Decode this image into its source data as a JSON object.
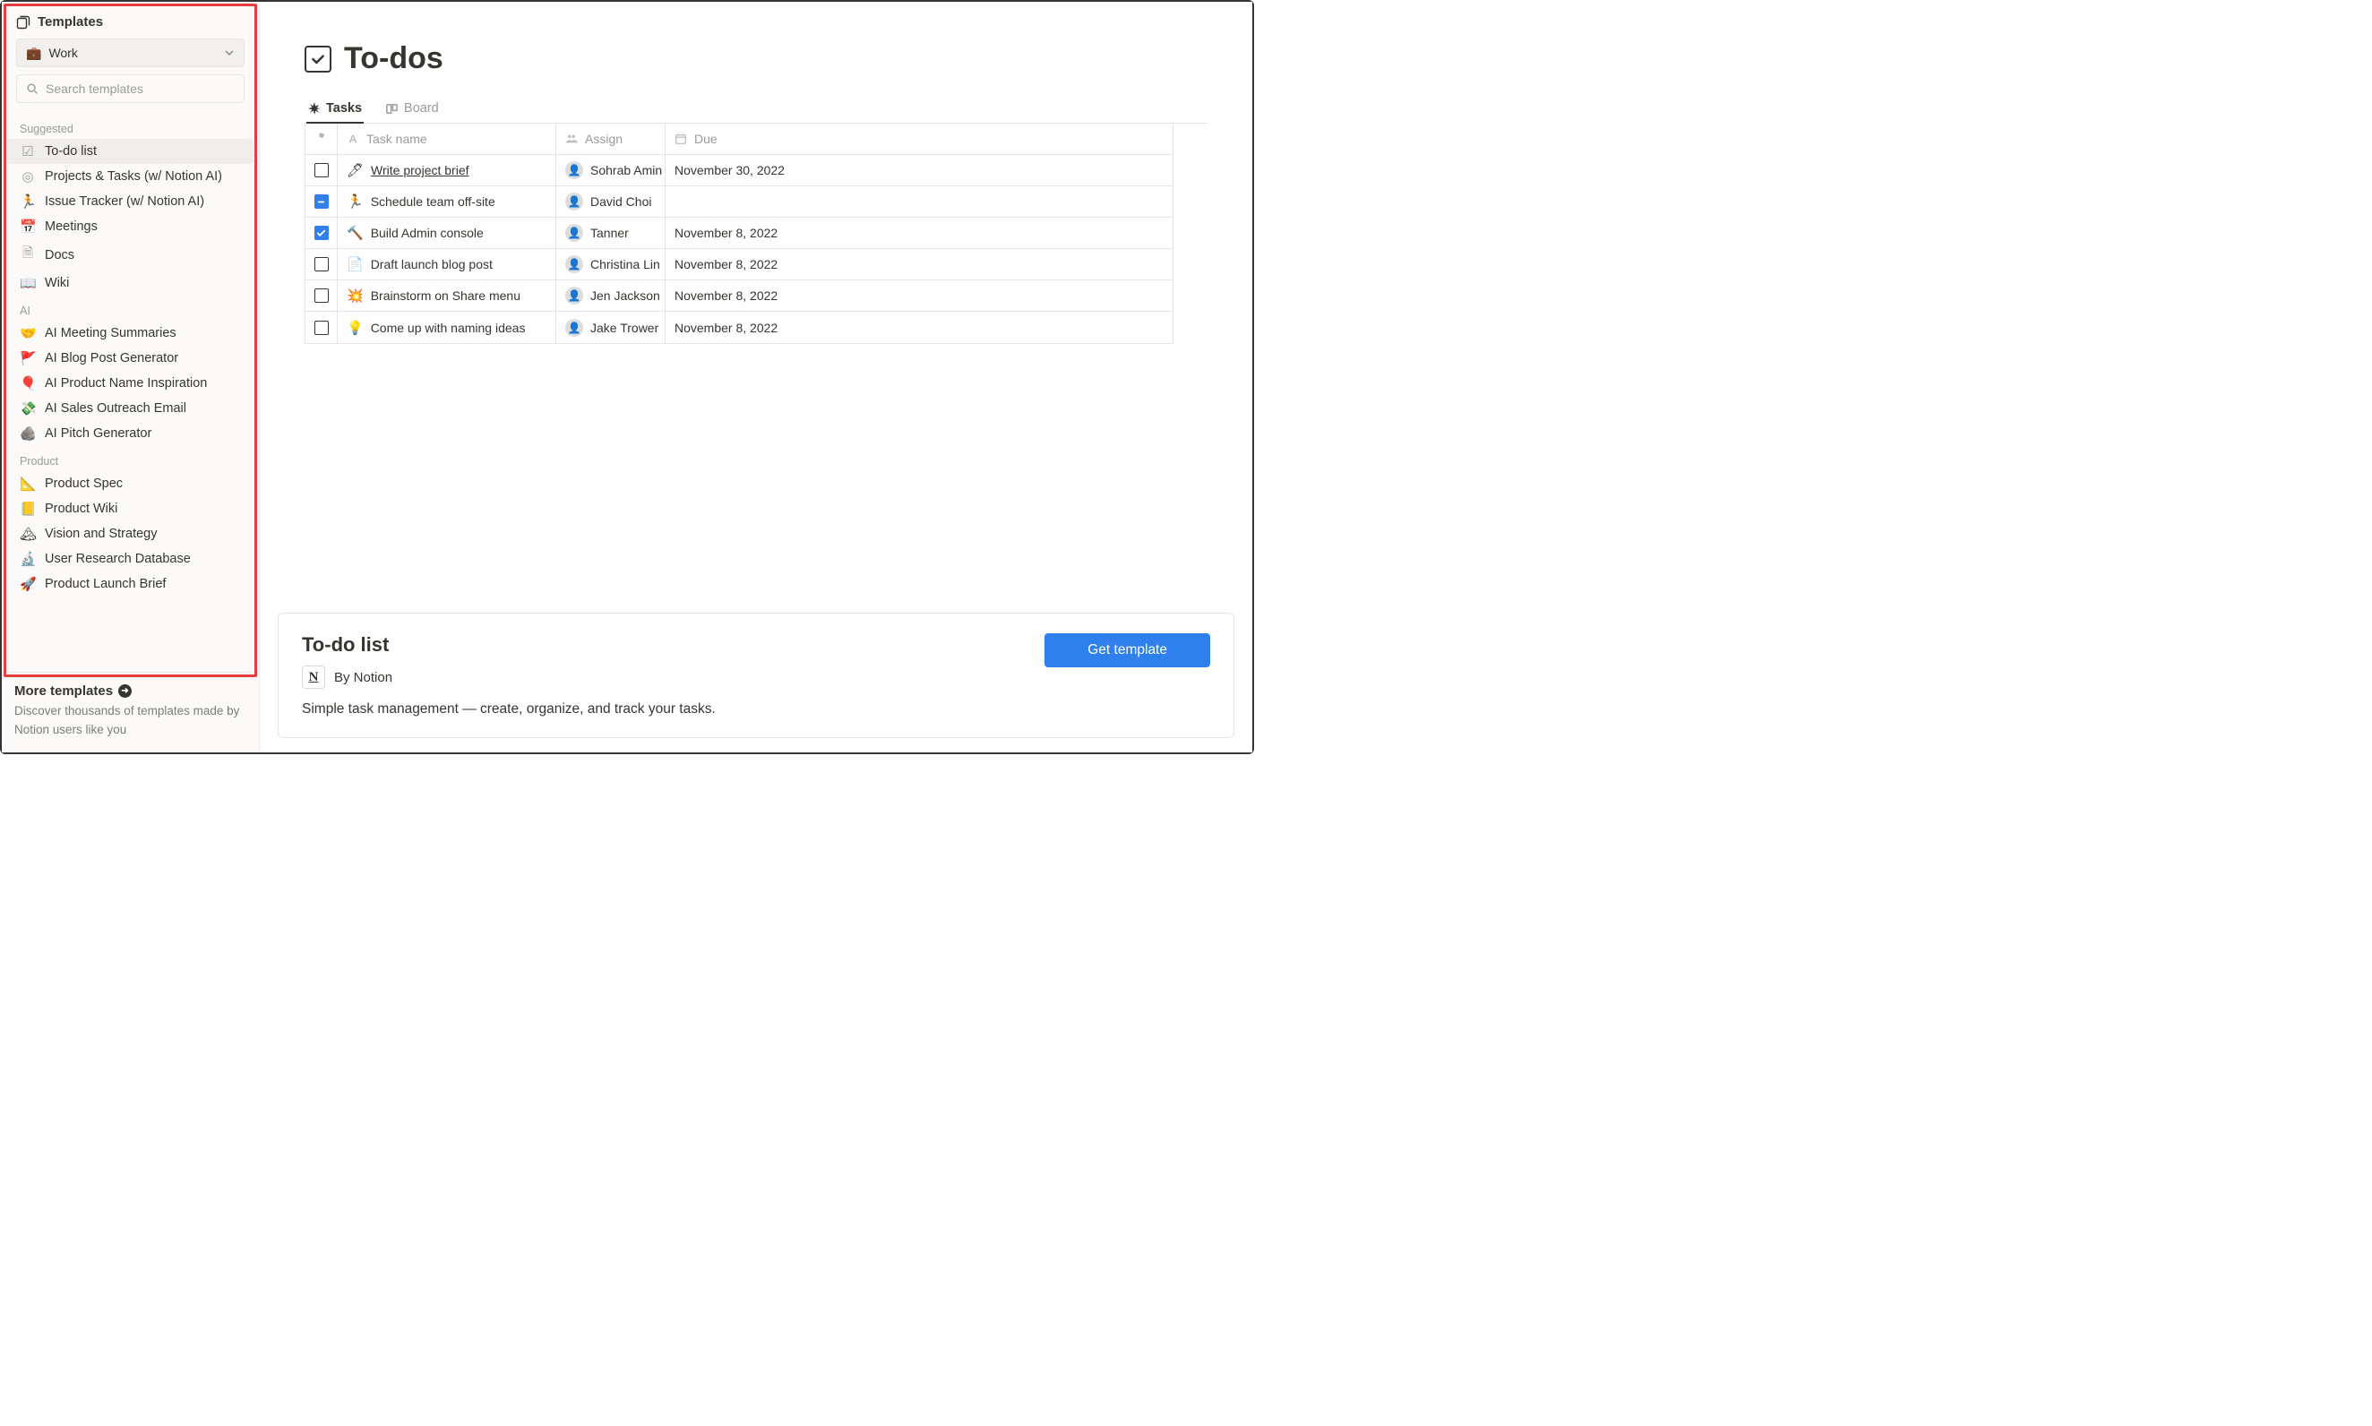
{
  "sidebar": {
    "title": "Templates",
    "category_selected": "Work",
    "search_placeholder": "Search templates",
    "sections": {
      "suggested": {
        "label": "Suggested",
        "items": [
          {
            "icon": "☑",
            "gray_icon": true,
            "label": "To-do list",
            "active": true
          },
          {
            "icon": "◎",
            "gray_icon": true,
            "label": "Projects & Tasks (w/ Notion AI)"
          },
          {
            "icon": "🏃",
            "gray_icon": true,
            "label": "Issue Tracker (w/ Notion AI)"
          },
          {
            "icon": "📅",
            "gray_icon": true,
            "label": "Meetings"
          },
          {
            "icon": "🗎",
            "gray_icon": true,
            "label": "Docs"
          },
          {
            "icon": "📖",
            "gray_icon": true,
            "label": "Wiki"
          }
        ]
      },
      "ai": {
        "label": "AI",
        "items": [
          {
            "icon": "🤝",
            "label": "AI Meeting Summaries"
          },
          {
            "icon": "🚩",
            "label": "AI Blog Post Generator"
          },
          {
            "icon": "🎈",
            "label": "AI Product Name Inspiration"
          },
          {
            "icon": "💸",
            "label": "AI Sales Outreach Email"
          },
          {
            "icon": "🪨",
            "label": "AI Pitch Generator"
          }
        ]
      },
      "product": {
        "label": "Product",
        "items": [
          {
            "icon": "📐",
            "label": "Product Spec"
          },
          {
            "icon": "📒",
            "label": "Product Wiki"
          },
          {
            "icon": "🏔",
            "label": "Vision and Strategy"
          },
          {
            "icon": "🔬",
            "label": "User Research Database"
          },
          {
            "icon": "🚀",
            "label": "Product Launch Brief"
          }
        ]
      }
    },
    "footer": {
      "more": "More templates",
      "desc": "Discover thousands of templates made by Notion users like you"
    }
  },
  "main": {
    "title": "To-dos",
    "tabs": [
      {
        "label": "Tasks",
        "active": true
      },
      {
        "label": "Board"
      }
    ],
    "columns": {
      "name": "Task name",
      "assign": "Assign",
      "due": "Due"
    },
    "rows": [
      {
        "check": "empty",
        "emoji": "🖊",
        "name": "Write project brief",
        "underline": true,
        "assignee": "Sohrab Amin",
        "due": "November 30, 2022"
      },
      {
        "check": "minus",
        "emoji": "🏃",
        "name": "Schedule team off-site",
        "underline": false,
        "assignee": "David Choi",
        "due": ""
      },
      {
        "check": "checked",
        "emoji": "🔨",
        "name": "Build Admin console",
        "underline": false,
        "assignee": "Tanner",
        "due": "November 8, 2022"
      },
      {
        "check": "empty",
        "emoji": "📄",
        "name": "Draft launch blog post",
        "underline": false,
        "assignee": "Christina Lin",
        "due": "November 8, 2022"
      },
      {
        "check": "empty",
        "emoji": "💥",
        "name": "Brainstorm on Share menu",
        "underline": false,
        "assignee": "Jen Jackson",
        "due": "November 8, 2022"
      },
      {
        "check": "empty",
        "emoji": "💡",
        "name": "Come up with naming ideas",
        "underline": false,
        "assignee": "Jake Trower",
        "due": "November 8, 2022"
      }
    ]
  },
  "card": {
    "title": "To-do list",
    "by": "By Notion",
    "desc": "Simple task management — create, organize, and track your tasks.",
    "button": "Get template"
  }
}
